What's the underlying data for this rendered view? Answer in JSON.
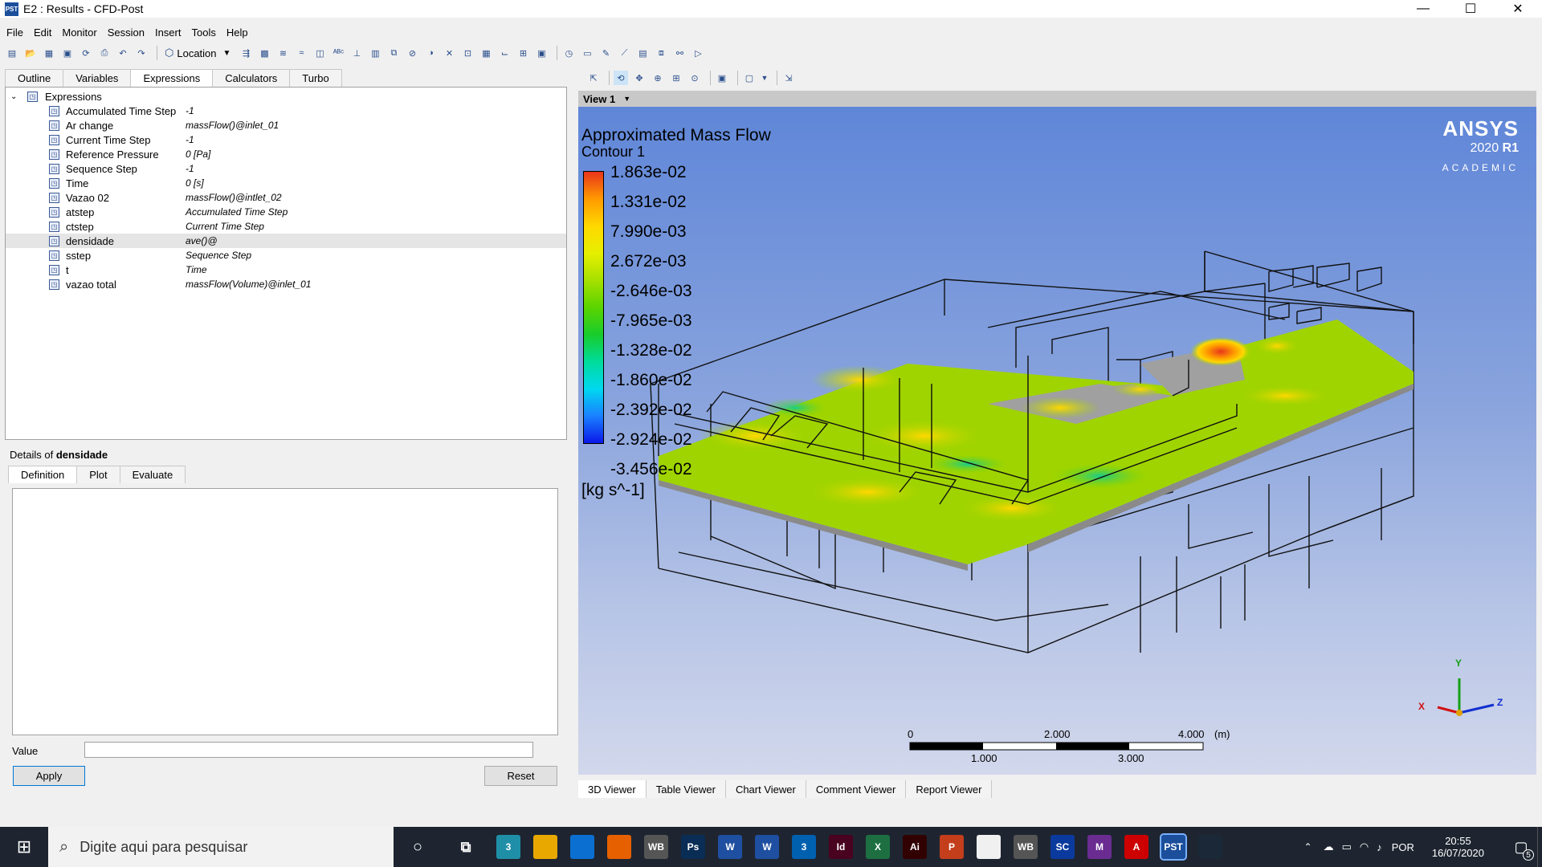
{
  "window": {
    "title": "E2 : Results - CFD-Post",
    "icon_label": "PST",
    "minimize": "—",
    "maximize": "☐",
    "close": "✕"
  },
  "menu": [
    "File",
    "Edit",
    "Monitor",
    "Session",
    "Insert",
    "Tools",
    "Help"
  ],
  "toolbar": {
    "location_label": "Location"
  },
  "left_tabs": [
    "Outline",
    "Variables",
    "Expressions",
    "Calculators",
    "Turbo"
  ],
  "tree": {
    "root": "Expressions",
    "items": [
      {
        "name": "Accumulated Time Step",
        "value": "-1"
      },
      {
        "name": "Ar change",
        "value": "massFlow()@inlet_01"
      },
      {
        "name": "Current Time Step",
        "value": "-1"
      },
      {
        "name": "Reference Pressure",
        "value": "0 [Pa]"
      },
      {
        "name": "Sequence Step",
        "value": "-1"
      },
      {
        "name": "Time",
        "value": "0 [s]"
      },
      {
        "name": "Vazao 02",
        "value": "massFlow()@intlet_02"
      },
      {
        "name": "atstep",
        "value": "Accumulated Time Step"
      },
      {
        "name": "ctstep",
        "value": "Current Time Step"
      },
      {
        "name": "densidade",
        "value": "ave()@"
      },
      {
        "name": "sstep",
        "value": "Sequence Step"
      },
      {
        "name": "t",
        "value": "Time"
      },
      {
        "name": "vazao total",
        "value": "massFlow(Volume)@inlet_01"
      }
    ]
  },
  "details": {
    "prefix": "Details of ",
    "name": "densidade",
    "tabs": [
      "Definition",
      "Plot",
      "Evaluate"
    ],
    "value_label": "Value",
    "value": "",
    "apply": "Apply",
    "reset": "Reset"
  },
  "view": {
    "name": "View 1",
    "title": "Approximated Mass Flow",
    "subtitle": "Contour 1",
    "legend": [
      "1.863e-02",
      "1.331e-02",
      "7.990e-03",
      "2.672e-03",
      "-2.646e-03",
      "-7.965e-03",
      "-1.328e-02",
      "-1.860e-02",
      "-2.392e-02",
      "-2.924e-02",
      "-3.456e-02"
    ],
    "legend_colors": [
      "#e8351c",
      "#ff9a00",
      "#ffd800",
      "#e7ef00",
      "#a6e000",
      "#5ad400",
      "#18cc2c",
      "#00dc9c",
      "#00d8f0",
      "#1a80ff",
      "#0b18e8"
    ],
    "units": "[kg s^-1]",
    "brand": "ANSYS",
    "version": "2020",
    "release": "R1",
    "edition": "ACADEMIC",
    "scale": {
      "top": [
        "0",
        "2.000",
        "4.000",
        "(m)"
      ],
      "bottom": [
        "1.000",
        "3.000"
      ]
    },
    "axes": {
      "x": "X",
      "y": "Y",
      "z": "Z"
    }
  },
  "bottom_tabs": [
    "3D Viewer",
    "Table Viewer",
    "Chart Viewer",
    "Comment Viewer",
    "Report Viewer"
  ],
  "taskbar": {
    "search_placeholder": "Digite aqui para pesquisar",
    "apps": [
      "3",
      "",
      "",
      "",
      "WB",
      "Ps",
      "W",
      "W",
      "3",
      "Id",
      "X",
      "Ai",
      "P",
      "",
      "WB",
      "SC",
      "M",
      "A",
      "PST",
      ""
    ],
    "lang": "POR",
    "time": "20:55",
    "date": "16/07/2020",
    "notifications": "5"
  }
}
